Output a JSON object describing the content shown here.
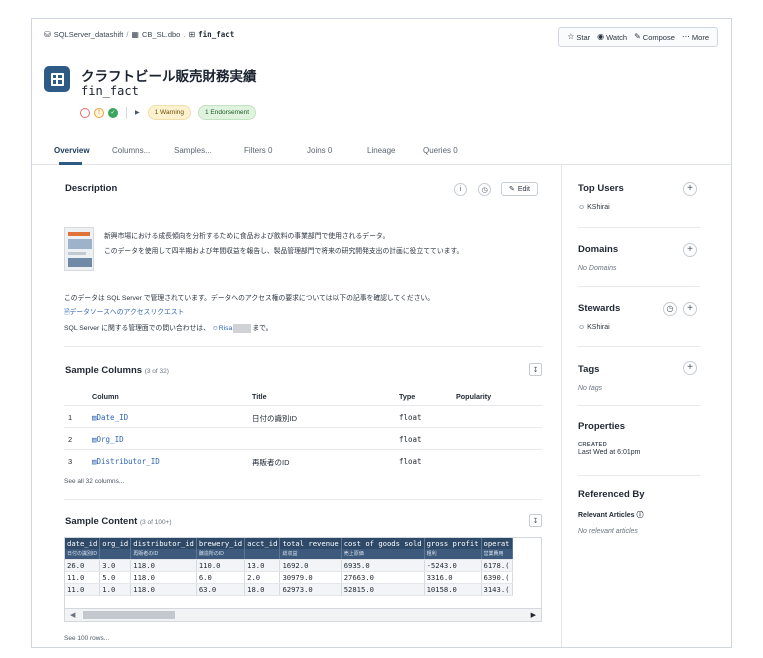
{
  "breadcrumb": {
    "source": "SQLServer_datashift",
    "separator": "/",
    "schema": "CB_SL.dbo",
    "dot": ".",
    "table": "fin_fact"
  },
  "actions": {
    "star": "Star",
    "watch": "Watch",
    "compose": "Compose",
    "more": "More"
  },
  "header": {
    "title": "クラフトビール販売財務実績",
    "code": "fin_fact"
  },
  "badges": {
    "warning": "1 Warning",
    "endorsement": "1 Endorsement"
  },
  "tabs": [
    {
      "label": "Overview"
    },
    {
      "label": "Columns..."
    },
    {
      "label": "Samples..."
    },
    {
      "label": "Filters 0"
    },
    {
      "label": "Joins 0"
    },
    {
      "label": "Lineage"
    },
    {
      "label": "Queries 0"
    }
  ],
  "description": {
    "title": "Description",
    "edit_label": "Edit",
    "line1": "新興市場における成長傾向を分析するために食品および飲料の事業部門で使用されるデータ。",
    "line2": "このデータを使用して四半期および年間収益を報告し、製品管理部門で将来の研究開発支出の計画に役立てています。",
    "line3": "このデータは SQL Server で管理されています。データへのアクセス権の要求については以下の記事を確認してください。",
    "link": "データソースへのアクセスリクエスト",
    "contact_prefix": "SQL Server に関する管理面での問い合わせは、",
    "contact_user": "Risa",
    "contact_suffix": "まで。"
  },
  "sample_columns": {
    "title": "Sample Columns",
    "count": "(3 of 32)",
    "headers": {
      "column": "Column",
      "title": "Title",
      "type": "Type",
      "popularity": "Popularity"
    },
    "rows": [
      {
        "num": "1",
        "name": "Date_ID",
        "title": "日付の識別ID",
        "type": "float"
      },
      {
        "num": "2",
        "name": "Org_ID",
        "title": "",
        "type": "float"
      },
      {
        "num": "3",
        "name": "Distributor_ID",
        "title": "再販者のID",
        "type": "float"
      }
    ],
    "see_all": "See all 32 columns..."
  },
  "sample_content": {
    "title": "Sample Content",
    "count": "(3 of 100+)",
    "headers": [
      "date_id",
      "org_id",
      "distributor_id",
      "brewery_id",
      "acct_id",
      "total revenue",
      "cost of goods sold",
      "gross profit",
      "operat"
    ],
    "subheaders": [
      "日付の識別ID",
      "",
      "再販者のID",
      "醸造所のID",
      "",
      "総収益",
      "売上原価",
      "粗利",
      "営業費用"
    ],
    "rows": [
      [
        "26.0",
        "3.0",
        "118.0",
        "110.0",
        "13.0",
        "1692.0",
        "6935.0",
        "-5243.0",
        "6178.("
      ],
      [
        "11.0",
        "5.0",
        "118.0",
        "6.0",
        "2.0",
        "30979.0",
        "27663.0",
        "3316.0",
        "6390.("
      ],
      [
        "11.0",
        "1.0",
        "118.0",
        "63.0",
        "18.0",
        "62973.0",
        "52815.0",
        "10158.0",
        "3143.("
      ]
    ],
    "see_rows": "See 100 rows..."
  },
  "sidebar": {
    "top_users": {
      "title": "Top Users",
      "value": "KShirai"
    },
    "domains": {
      "title": "Domains",
      "empty": "No Domains"
    },
    "stewards": {
      "title": "Stewards",
      "value": "KShirai"
    },
    "tags": {
      "title": "Tags",
      "empty": "No tags"
    },
    "properties": {
      "title": "Properties",
      "label": "CREATED",
      "value": "Last Wed at 6:01pm"
    },
    "referenced_by": {
      "title": "Referenced By",
      "label": "Relevant Articles",
      "empty": "No relevant articles"
    }
  },
  "colors": {
    "brand": "#2e5a86",
    "link": "#2f66b3",
    "table_header": "#2f4a69"
  }
}
